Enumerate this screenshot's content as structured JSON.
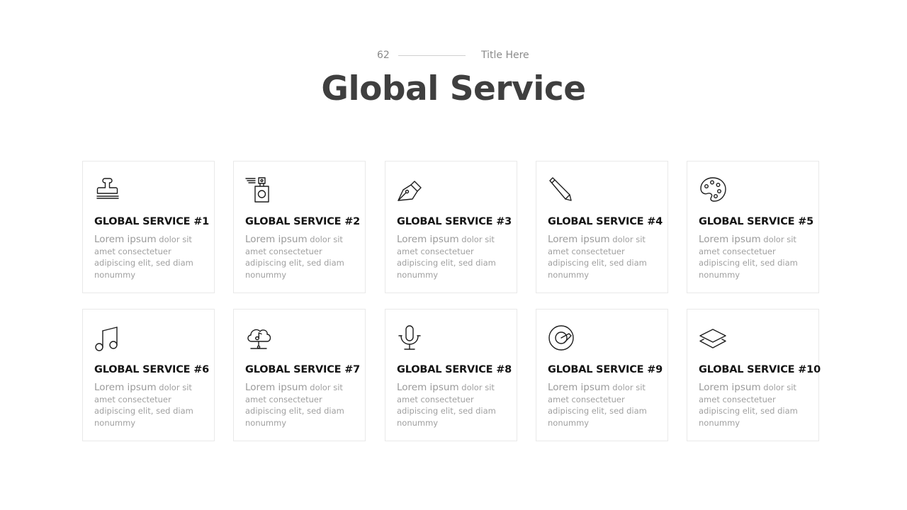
{
  "header": {
    "page_number": "62",
    "subtitle": "Title Here",
    "title": "Global Service"
  },
  "cards": [
    {
      "icon": "stamp-icon",
      "title": "GLOBAL SERVICE #1",
      "lead": "Lorem ipsum",
      "body": " dolor sit amet consectetuer adipiscing elit, sed diam nonummy"
    },
    {
      "icon": "perfume-icon",
      "title": "GLOBAL SERVICE #2",
      "lead": "Lorem ipsum",
      "body": " dolor sit amet consectetuer adipiscing elit, sed diam nonummy"
    },
    {
      "icon": "pen-nib-icon",
      "title": "GLOBAL SERVICE #3",
      "lead": "Lorem ipsum",
      "body": " dolor sit amet consectetuer adipiscing elit, sed diam nonummy"
    },
    {
      "icon": "pencil-icon",
      "title": "GLOBAL SERVICE #4",
      "lead": "Lorem ipsum",
      "body": " dolor sit amet consectetuer adipiscing elit, sed diam nonummy"
    },
    {
      "icon": "palette-icon",
      "title": "GLOBAL SERVICE #5",
      "lead": "Lorem ipsum",
      "body": " dolor sit amet consectetuer adipiscing elit, sed diam nonummy"
    },
    {
      "icon": "music-note-icon",
      "title": "GLOBAL SERVICE #6",
      "lead": "Lorem ipsum",
      "body": " dolor sit amet consectetuer adipiscing elit, sed diam nonummy"
    },
    {
      "icon": "cloud-music-icon",
      "title": "GLOBAL SERVICE #7",
      "lead": "Lorem ipsum",
      "body": " dolor sit amet consectetuer adipiscing elit, sed diam nonummy"
    },
    {
      "icon": "microphone-icon",
      "title": "GLOBAL SERVICE #8",
      "lead": "Lorem ipsum",
      "body": " dolor sit amet consectetuer adipiscing elit, sed diam nonummy"
    },
    {
      "icon": "record-disc-icon",
      "title": "GLOBAL SERVICE #9",
      "lead": "Lorem ipsum",
      "body": " dolor sit amet consectetuer adipiscing elit, sed diam nonummy"
    },
    {
      "icon": "layers-icon",
      "title": "GLOBAL SERVICE #10",
      "lead": "Lorem ipsum",
      "body": " dolor sit amet consectetuer adipiscing elit, sed diam nonummy"
    }
  ]
}
